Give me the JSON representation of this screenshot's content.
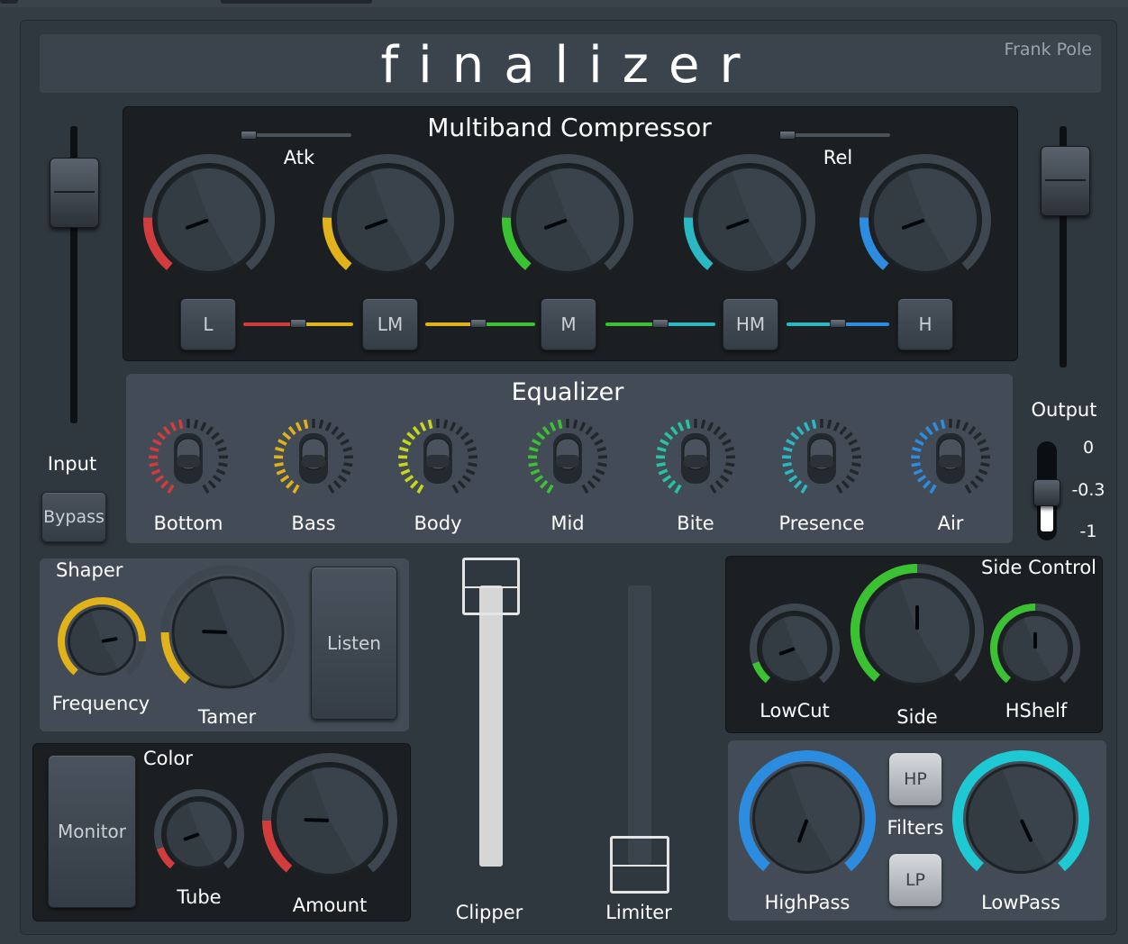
{
  "app": {
    "title": "finalizer",
    "author": "Frank Pole"
  },
  "compressor": {
    "title": "Multiband Compressor",
    "atk_label": "Atk",
    "rel_label": "Rel",
    "bands": [
      {
        "label": "L",
        "color": "#d23c3c",
        "value": 0.1
      },
      {
        "label": "LM",
        "color": "#e2b21a",
        "value": 0.1
      },
      {
        "label": "M",
        "color": "#3bc232",
        "value": 0.1
      },
      {
        "label": "HM",
        "color": "#2ab9c4",
        "value": 0.1
      },
      {
        "label": "H",
        "color": "#2c8de0",
        "value": 0.1
      }
    ]
  },
  "input": {
    "label": "Input",
    "bypass_label": "Bypass"
  },
  "output": {
    "label": "Output",
    "scale": [
      "0",
      "-0.3",
      "-1"
    ]
  },
  "equalizer": {
    "title": "Equalizer",
    "bands": [
      {
        "label": "Bottom",
        "color": "#d23c3c"
      },
      {
        "label": "Bass",
        "color": "#e2b21a"
      },
      {
        "label": "Body",
        "color": "#c8d61c"
      },
      {
        "label": "Mid",
        "color": "#3bc232"
      },
      {
        "label": "Bite",
        "color": "#27c4a4"
      },
      {
        "label": "Presence",
        "color": "#2ab9c4"
      },
      {
        "label": "Air",
        "color": "#2c8de0"
      }
    ]
  },
  "shaper": {
    "title": "Shaper",
    "frequency_label": "Frequency",
    "tamer_label": "Tamer",
    "listen_label": "Listen"
  },
  "color_section": {
    "title": "Color",
    "monitor_label": "Monitor",
    "tube_label": "Tube",
    "amount_label": "Amount"
  },
  "clipper": {
    "label": "Clipper"
  },
  "limiter": {
    "label": "Limiter"
  },
  "side_control": {
    "title": "Side Control",
    "lowcut_label": "LowCut",
    "side_label": "Side",
    "hshelf_label": "HShelf"
  },
  "filters": {
    "label": "Filters",
    "hp_label": "HP",
    "lp_label": "LP",
    "highpass_label": "HighPass",
    "lowpass_label": "LowPass"
  },
  "colors": {
    "accent_green": "#3bc232",
    "accent_yellow": "#e2b21a",
    "accent_blue": "#2c8de0",
    "accent_cyan": "#1ec9d4",
    "accent_red": "#d23c3c"
  }
}
